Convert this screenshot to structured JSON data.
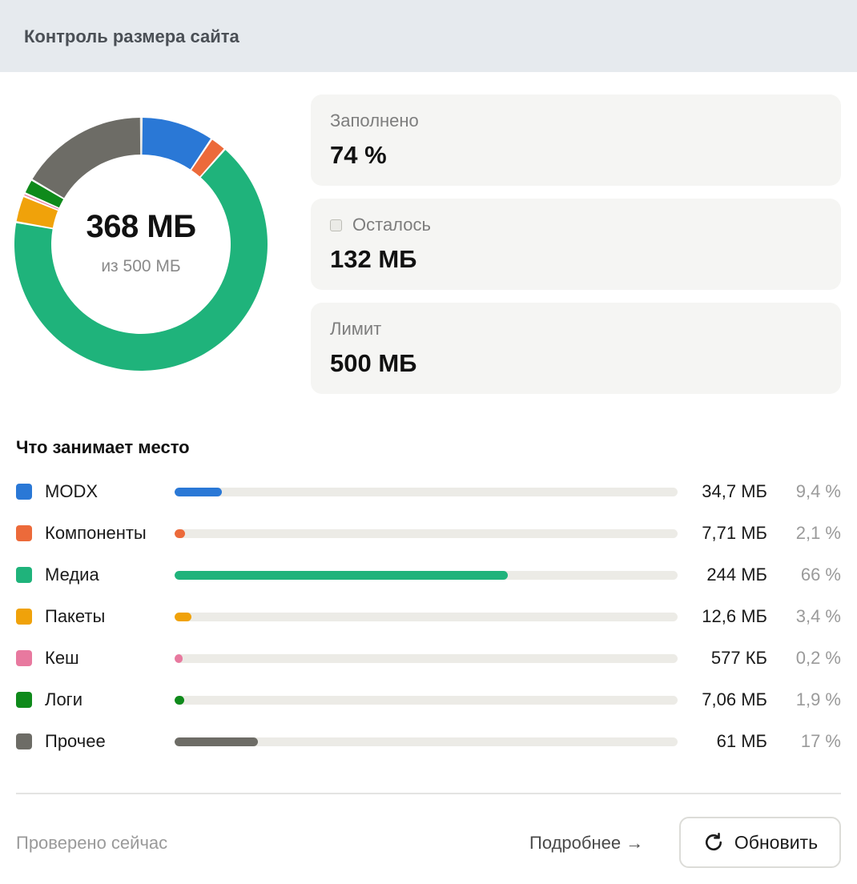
{
  "header": {
    "title": "Контроль размера сайта"
  },
  "summary": {
    "used": "368 МБ",
    "of_total": "из 500 МБ",
    "used_fraction": 0.74
  },
  "cards": {
    "filled": {
      "label": "Заполнено",
      "value": "74 %"
    },
    "remaining": {
      "label": "Осталось",
      "value": "132 МБ",
      "swatch_color": "#ebebe7"
    },
    "limit": {
      "label": "Лимит",
      "value": "500 МБ"
    }
  },
  "breakdown": {
    "title": "Что занимает место",
    "items": [
      {
        "name": "MODX",
        "size": "34,7 МБ",
        "percent": "9,4 %",
        "fraction": 0.094,
        "color": "#2a78d6"
      },
      {
        "name": "Компоненты",
        "size": "7,71 МБ",
        "percent": "2,1 %",
        "fraction": 0.021,
        "color": "#ec6a3a"
      },
      {
        "name": "Медиа",
        "size": "244 МБ",
        "percent": "66 %",
        "fraction": 0.663,
        "color": "#1fb37b"
      },
      {
        "name": "Пакеты",
        "size": "12,6 МБ",
        "percent": "3,4 %",
        "fraction": 0.034,
        "color": "#f0a20a"
      },
      {
        "name": "Кеш",
        "size": "577 КБ",
        "percent": "0,2 %",
        "fraction": 0.002,
        "color": "#e8799f"
      },
      {
        "name": "Логи",
        "size": "7,06 МБ",
        "percent": "1,9 %",
        "fraction": 0.019,
        "color": "#0f8a1b"
      },
      {
        "name": "Прочее",
        "size": "61 МБ",
        "percent": "17 %",
        "fraction": 0.166,
        "color": "#6d6c66"
      }
    ],
    "free_color": "#ebebe7"
  },
  "footer": {
    "status": "Проверено сейчас",
    "details_link": "Подробнее →",
    "refresh_label": "Обновить"
  }
}
